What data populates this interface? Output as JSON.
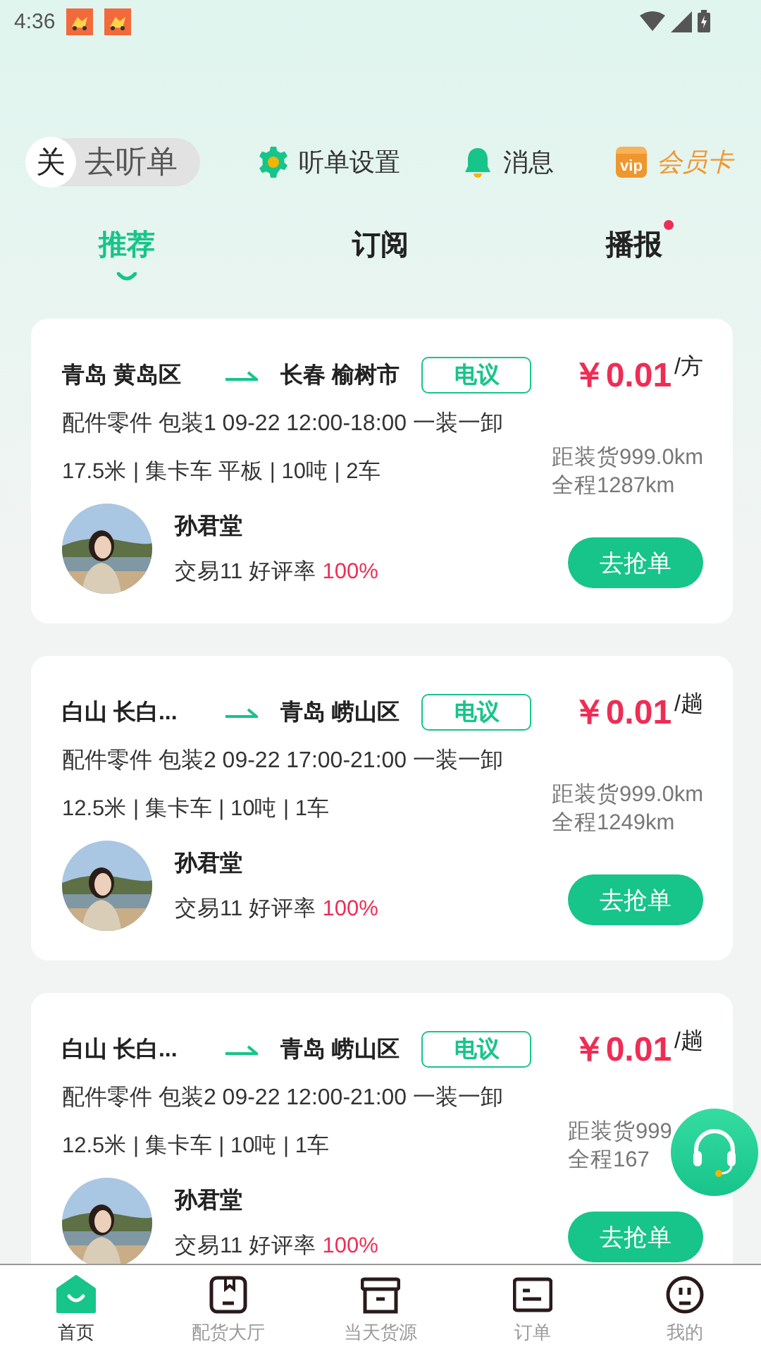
{
  "status_bar": {
    "time": "4:36"
  },
  "listen_toggle": {
    "on": false,
    "state_label": "关",
    "label": "去听单"
  },
  "top_actions": [
    {
      "kind": "settings",
      "label": "听单设置"
    },
    {
      "kind": "bell",
      "label": "消息"
    },
    {
      "kind": "vip",
      "label": "会员卡",
      "icon_text": "vip"
    }
  ],
  "tabs": [
    {
      "label": "推荐",
      "selected": true,
      "badge": false
    },
    {
      "label": "订阅",
      "selected": false,
      "badge": false
    },
    {
      "label": "播报",
      "selected": false,
      "badge": true
    }
  ],
  "orders": [
    {
      "from": "青岛 黄岛区",
      "to": "长春 榆树市",
      "tag": "电议",
      "price": "￥0.01",
      "unit": "/方",
      "cargo": "配件零件 包装1 09-22 12:00-18:00 一装一卸",
      "vehicle": "17.5米 | 集卡车 平板 | 10吨 | 2车",
      "distance": "距装货999.0km",
      "total": "全程1287km",
      "name": "孙君堂",
      "stats": "交易11 好评率",
      "rating": "100%",
      "action": "去抢单"
    },
    {
      "from": "白山 长白...",
      "to": "青岛 崂山区",
      "tag": "电议",
      "price": "￥0.01",
      "unit": "/趟",
      "cargo": "配件零件 包装2 09-22 17:00-21:00 一装一卸",
      "vehicle": "12.5米 | 集卡车 | 10吨 | 1车",
      "distance": "距装货999.0km",
      "total": "全程1249km",
      "name": "孙君堂",
      "stats": "交易11 好评率",
      "rating": "100%",
      "action": "去抢单"
    },
    {
      "from": "白山 长白...",
      "to": "青岛 崂山区",
      "tag": "电议",
      "price": "￥0.01",
      "unit": "/趟",
      "cargo": "配件零件 包装2 09-22 12:00-21:00 一装一卸",
      "vehicle": "12.5米 | 集卡车 | 10吨 | 1车",
      "distance": "距装货999",
      "total": "全程167",
      "name": "孙君堂",
      "stats": "交易11 好评率",
      "rating": "100%",
      "action": "去抢单"
    }
  ],
  "bottom_nav": [
    {
      "kind": "home",
      "label": "首页",
      "selected": true
    },
    {
      "kind": "book",
      "label": "配货大厅",
      "selected": false
    },
    {
      "kind": "archive",
      "label": "当天货源",
      "selected": false
    },
    {
      "kind": "list",
      "label": "订单",
      "selected": false
    },
    {
      "kind": "face",
      "label": "我的",
      "selected": false
    }
  ]
}
